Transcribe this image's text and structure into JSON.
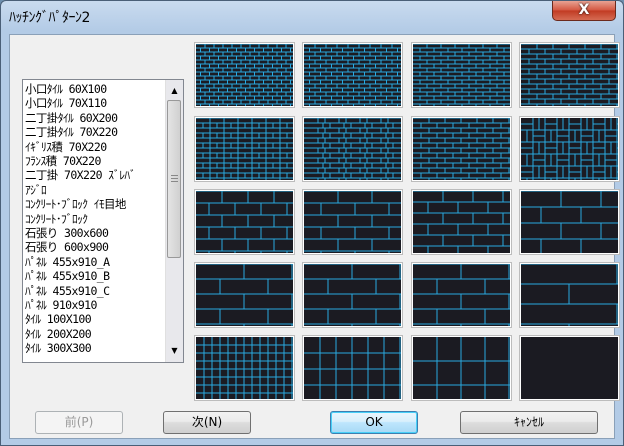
{
  "window": {
    "title": "ﾊｯﾁﾝｸﾞﾊﾟﾀｰﾝ2",
    "close_label": "X"
  },
  "pattern_list": {
    "items": [
      "小口ﾀｲﾙ 60X100",
      "小口ﾀｲﾙ 70X110",
      "二丁掛ﾀｲﾙ 60X200",
      "二丁掛ﾀｲﾙ 70X220",
      "ｲｷﾞﾘｽ積 70X220",
      "ﾌﾗﾝｽ積 70X220",
      "二丁掛 70X220 ｽﾞﾚﾊﾞ",
      "ｱｼﾞﾛ",
      "ｺﾝｸﾘｰﾄ･ﾌﾞﾛｯｸ ｲﾓ目地",
      "ｺﾝｸﾘｰﾄ･ﾌﾞﾛｯｸ",
      "石張り 300x600",
      "石張り 600x900",
      "ﾊﾟﾈﾙ 455x910_A",
      "ﾊﾟﾈﾙ 455x910_B",
      "ﾊﾟﾈﾙ 455x910_C",
      "ﾊﾟﾈﾙ 910x910",
      "ﾀｲﾙ 100X100",
      "ﾀｲﾙ 200X200",
      "ﾀｲﾙ 300X300"
    ],
    "scroll_up_icon": "triangle-up",
    "scroll_down_icon": "triangle-down"
  },
  "previews": {
    "line_color": "#2aa9e0",
    "background_color": "#1b1b22"
  },
  "buttons": {
    "prev": "前(P)",
    "next": "次(N)",
    "ok": "OK",
    "cancel": "ｷｬﾝｾﾙ"
  }
}
